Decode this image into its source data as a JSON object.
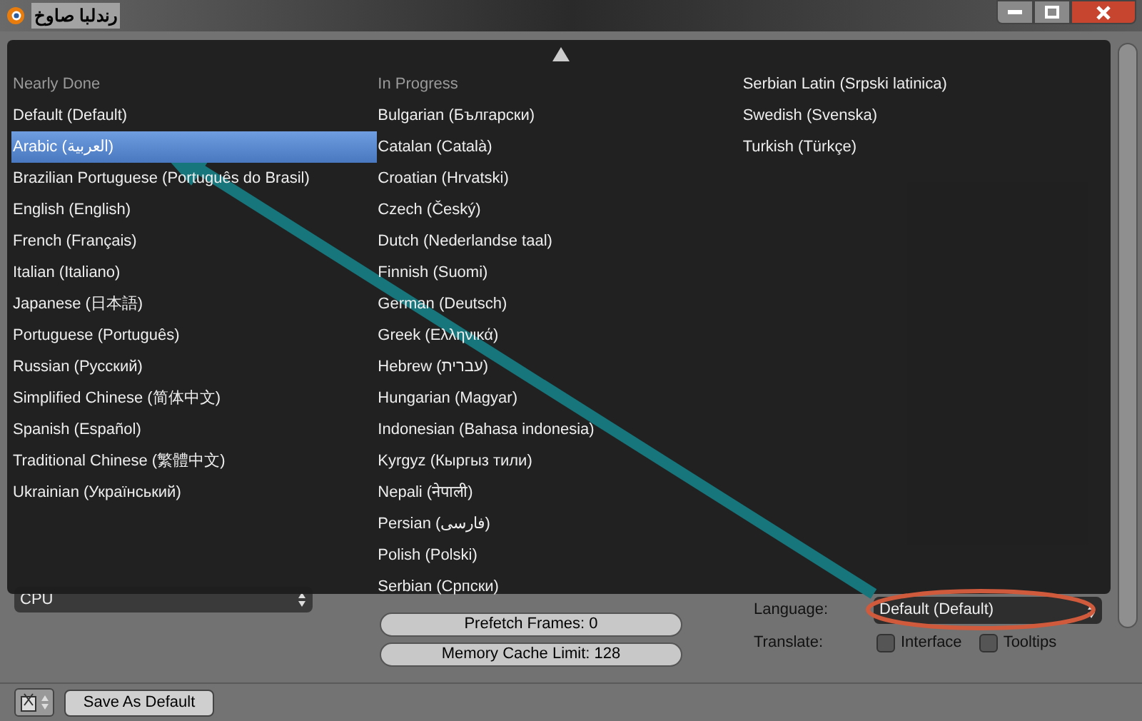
{
  "window": {
    "title": "رندلبا صاوخ"
  },
  "language_menu": {
    "columns": [
      {
        "heading": "Nearly Done",
        "items": [
          {
            "label": "Default (Default)",
            "selected": false
          },
          {
            "label": "Arabic (العربية)",
            "selected": true
          },
          {
            "label": "Brazilian Portuguese (Português do Brasil)",
            "selected": false
          },
          {
            "label": "English (English)",
            "selected": false
          },
          {
            "label": "French (Français)",
            "selected": false
          },
          {
            "label": "Italian (Italiano)",
            "selected": false
          },
          {
            "label": "Japanese (日本語)",
            "selected": false
          },
          {
            "label": "Portuguese (Português)",
            "selected": false
          },
          {
            "label": "Russian (Русский)",
            "selected": false
          },
          {
            "label": "Simplified Chinese (简体中文)",
            "selected": false
          },
          {
            "label": "Spanish (Español)",
            "selected": false
          },
          {
            "label": "Traditional Chinese (繁體中文)",
            "selected": false
          },
          {
            "label": "Ukrainian (Український)",
            "selected": false
          }
        ]
      },
      {
        "heading": "In Progress",
        "items": [
          {
            "label": "Bulgarian (Български)",
            "selected": false
          },
          {
            "label": "Catalan (Català)",
            "selected": false
          },
          {
            "label": "Croatian (Hrvatski)",
            "selected": false
          },
          {
            "label": "Czech (Český)",
            "selected": false
          },
          {
            "label": "Dutch (Nederlandse taal)",
            "selected": false
          },
          {
            "label": "Finnish (Suomi)",
            "selected": false
          },
          {
            "label": "German (Deutsch)",
            "selected": false
          },
          {
            "label": "Greek (Ελληνικά)",
            "selected": false
          },
          {
            "label": "Hebrew (עברית)",
            "selected": false
          },
          {
            "label": "Hungarian (Magyar)",
            "selected": false
          },
          {
            "label": "Indonesian (Bahasa indonesia)",
            "selected": false
          },
          {
            "label": "Kyrgyz (Кыргыз тили)",
            "selected": false
          },
          {
            "label": "Nepali (नेपाली)",
            "selected": false
          },
          {
            "label": "Persian (فارسی)",
            "selected": false
          },
          {
            "label": "Polish (Polski)",
            "selected": false
          },
          {
            "label": "Serbian (Српски)",
            "selected": false
          }
        ]
      },
      {
        "items": [
          {
            "label": "Serbian Latin (Srpski latinica)",
            "selected": false
          },
          {
            "label": "Swedish (Svenska)",
            "selected": false
          },
          {
            "label": "Turkish (Türkçe)",
            "selected": false
          }
        ]
      }
    ]
  },
  "compute_device": {
    "value": "CPU"
  },
  "sequencer": {
    "fields": [
      "Prefetch Frames: 0",
      "Memory Cache Limit: 128"
    ]
  },
  "language": {
    "label": "Language:",
    "value": "Default (Default)"
  },
  "translate": {
    "label": "Translate:",
    "options": [
      {
        "label": "Interface",
        "checked": false
      },
      {
        "label": "Tooltips",
        "checked": false
      }
    ]
  },
  "footer": {
    "save_button": "Save As Default"
  }
}
